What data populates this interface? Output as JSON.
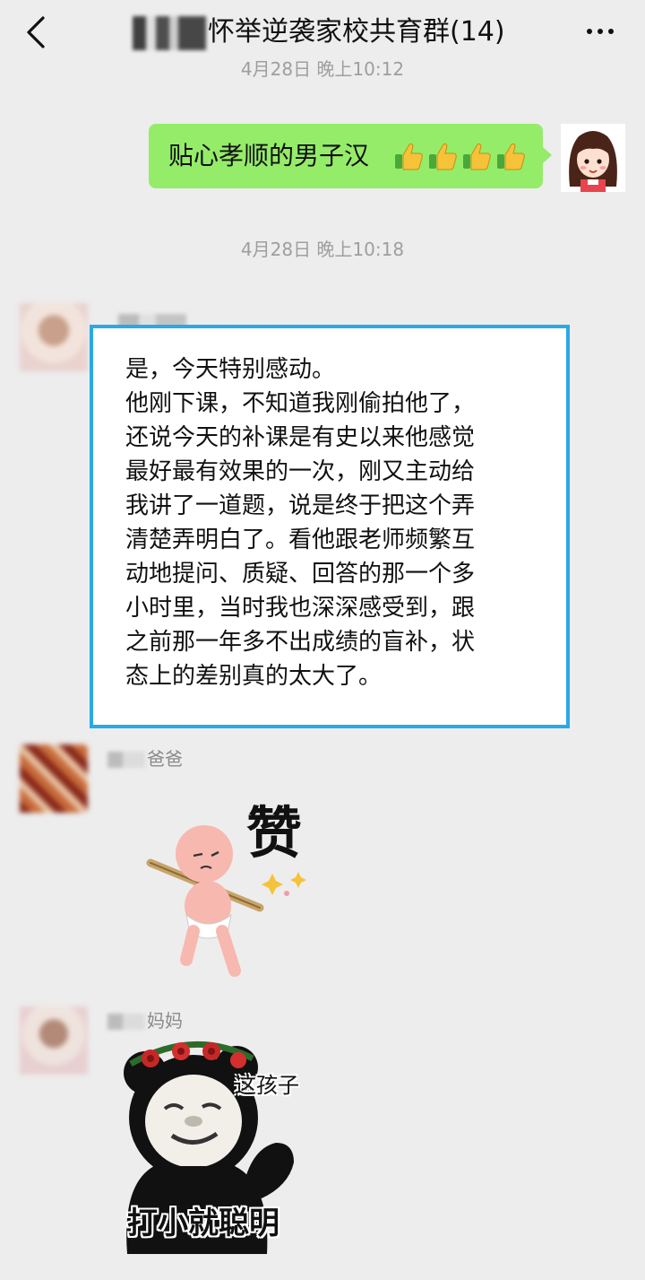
{
  "header": {
    "title": "怀举逆袭家校共育群(14)",
    "back_icon": "chevron-left-icon",
    "more_icon": "more-dots-icon"
  },
  "messages": [
    {
      "kind": "time",
      "text": "4月28日 晚上10:12"
    },
    {
      "kind": "self_text",
      "text": "贴心孝顺的男子汉",
      "emoji": [
        "thumbs-up-icon",
        "thumbs-up-icon",
        "thumbs-up-icon",
        "thumbs-up-icon"
      ]
    },
    {
      "kind": "time",
      "text": "4月28日 晚上10:18"
    },
    {
      "kind": "incoming_text",
      "lines": [
        "是，今天特别感动。",
        "他刚下课，不知道我刚偷拍他了，",
        "还说今天的补课是有史以来他感觉",
        "最好最有效果的一次，刚又主动给",
        "我讲了一道题，说是终于把这个弄",
        "清楚弄明白了。看他跟老师频繁互",
        "动地提问、质疑、回答的那一个多",
        "小时里，当时我也深深感受到，跟",
        "之前那一年多不出成绩的盲补，状",
        "态上的差别真的太大了。"
      ]
    },
    {
      "kind": "incoming_sticker",
      "sender_visible": "爸爸",
      "sticker_text": "赞"
    },
    {
      "kind": "incoming_sticker",
      "sender_visible": "妈妈",
      "sticker_top_text": "这孩子",
      "sticker_caption": "打小就聪明"
    }
  ],
  "colors": {
    "background": "#ededed",
    "self_bubble": "#95ec69",
    "highlight_border": "#29a9e6"
  }
}
